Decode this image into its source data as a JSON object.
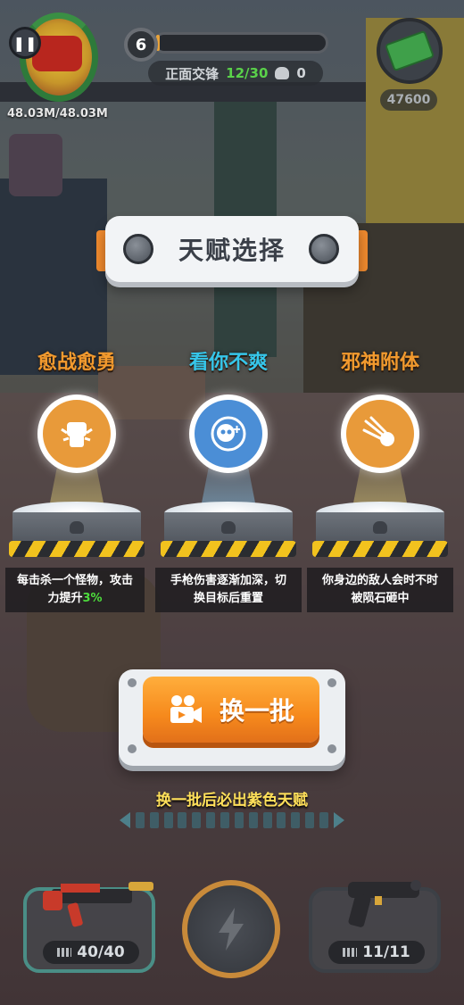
{
  "hud": {
    "hp": "48.03M/48.03M",
    "level": "6",
    "level_progress": 0.02,
    "wave_label": "正面交锋",
    "wave_count": "12/30",
    "kills": "0",
    "money": "47600"
  },
  "dialog": {
    "title": "天赋选择",
    "talents": [
      {
        "name": "愈战愈勇",
        "name_color": "#f29a2e",
        "icon": "fist-icon",
        "desc_line1": "每击杀一个怪物，攻击",
        "desc_line2_prefix": "力提升",
        "desc_highlight": "3%"
      },
      {
        "name": "看你不爽",
        "name_color": "#36c6ea",
        "icon": "skull-target-icon",
        "desc_line1": "手枪伤害逐渐加深，切",
        "desc_line2": "换目标后重置"
      },
      {
        "name": "邪神附体",
        "name_color": "#f29a2e",
        "icon": "meteor-icon",
        "desc_line1": "你身边的敌人会时不时",
        "desc_line2": "被陨石砸中"
      }
    ],
    "refresh_button": "换一批",
    "hint": "换一批后必出紫色天赋"
  },
  "weapons": {
    "primary_ammo": "40/40",
    "secondary_ammo": "11/11"
  },
  "colors": {
    "accent_orange": "#f6891c",
    "hint_yellow": "#ffe05a",
    "highlight_green": "#4ddc3c"
  }
}
